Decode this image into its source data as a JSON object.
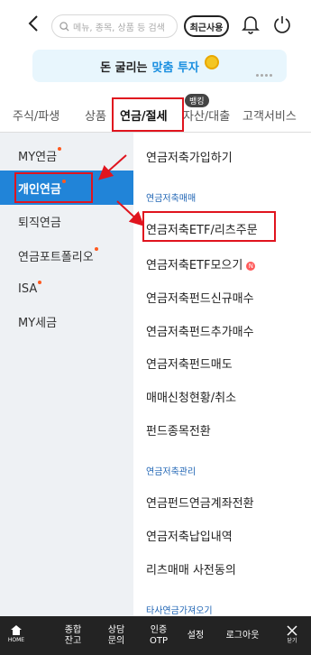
{
  "header": {
    "search_placeholder": "메뉴, 종목, 상품 등 검색",
    "recent_label": "최근사용"
  },
  "banner": {
    "text": "돈 굴리는",
    "accent_text": "맞춤 투자"
  },
  "tabs": [
    {
      "label": "주식/파생"
    },
    {
      "label": "상품"
    },
    {
      "label": "연금/절세",
      "active": true
    },
    {
      "label": "자산/대출"
    },
    {
      "label": "고객서비스"
    }
  ],
  "tab_badge": "뱅킹",
  "side_menu": [
    {
      "label": "MY연금",
      "dot": true
    },
    {
      "label": "개인연금",
      "dot": true,
      "active": true
    },
    {
      "label": "퇴직연금"
    },
    {
      "label": "연금포트폴리오",
      "dot": true
    },
    {
      "label": "ISA",
      "dot": true
    },
    {
      "label": "MY세금"
    }
  ],
  "content": {
    "item_top": "연금저축가입하기",
    "section1": "연금저축매매",
    "items1": [
      "연금저축ETF/리츠주문",
      "연금저축ETF모으기",
      "연금저축펀드신규매수",
      "연금저축펀드추가매수",
      "연금저축펀드매도",
      "매매신청현황/취소",
      "펀드종목전환"
    ],
    "new_badge": "N",
    "section2": "연금저축관리",
    "items2": [
      "연금펀드연금계좌전환",
      "연금저축납입내역",
      "리츠매매 사전동의"
    ],
    "section3_partial": "타사연금가져오기"
  },
  "bottom_bar": {
    "home_label": "HOME",
    "balance_line1": "종합",
    "balance_line2": "잔고",
    "consult_line1": "상담",
    "consult_line2": "문의",
    "otp_line1": "인증",
    "otp_line2": "OTP",
    "settings": "설정",
    "logout": "로그아웃",
    "close_label": "닫기"
  },
  "colors": {
    "accent_blue": "#2184d8",
    "highlight_red": "#e0141e",
    "side_bg": "#eef1f4",
    "bottom_bg": "#232323"
  }
}
